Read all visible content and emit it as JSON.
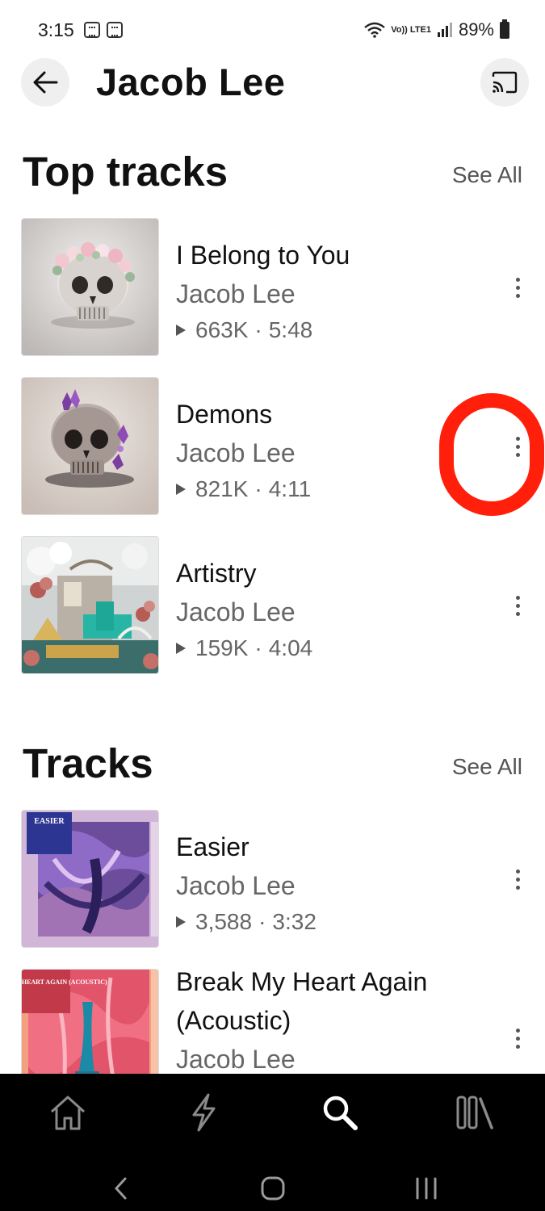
{
  "status": {
    "time": "3:15",
    "volte": "Vo)) LTE1",
    "battery": "89%"
  },
  "header": {
    "title": "Jacob Lee"
  },
  "top_tracks": {
    "title": "Top tracks",
    "see_all": "See All",
    "items": [
      {
        "title": "I Belong to You",
        "artist": "Jacob Lee",
        "plays": "663K",
        "duration": "5:48"
      },
      {
        "title": "Demons",
        "artist": "Jacob Lee",
        "plays": "821K",
        "duration": "4:11"
      },
      {
        "title": "Artistry",
        "artist": "Jacob Lee",
        "plays": "159K",
        "duration": "4:04"
      }
    ]
  },
  "tracks": {
    "title": "Tracks",
    "see_all": "See All",
    "items": [
      {
        "title": "Easier",
        "artist": "Jacob Lee",
        "plays": "3,588",
        "duration": "3:32",
        "art_text": "EASIER"
      },
      {
        "title": "Break My Heart Again (Acoustic)",
        "artist": "Jacob Lee",
        "art_text": "BREAK MY HEART AGAIN (ACOUSTIC)"
      }
    ]
  },
  "meta_separator": "·",
  "nav": {
    "items": [
      "home-icon",
      "bolt-icon",
      "search-icon",
      "library-icon"
    ],
    "active": "search-icon"
  },
  "colors": {
    "annotation_ring": "#ff1f0a",
    "nav_background": "#000000",
    "muted_text": "#666666"
  }
}
